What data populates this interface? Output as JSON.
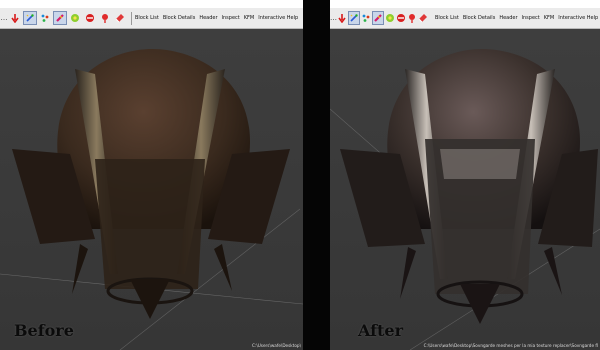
{
  "toolbar": {
    "menu": [
      "Block List",
      "Block Details",
      "Header",
      "Inspect",
      "KFM",
      "Interactive Help"
    ],
    "icons": [
      "arrow-down-icon",
      "magic-wand-icon",
      "select-icon",
      "nodes-icon",
      "no-textures-icon",
      "sphere-icon",
      "pin-icon",
      "eraser-icon"
    ]
  },
  "panels": {
    "before": {
      "caption": "Before",
      "status_path": "C:\\Users\\wafe\\Desktop\\"
    },
    "after": {
      "caption": "After",
      "status_path": "C:\\Users\\wafe\\Desktop\\Sovngarde meshes per la mia texture replacer\\Sovngarde fl"
    }
  },
  "colors": {
    "viewport_bg": "#3b3b3b",
    "toolbar_bg": "#ebebeb",
    "divider": "#000000",
    "mesh_before_tint": "#3a2a1e",
    "mesh_after_tint": "#2c2523"
  }
}
